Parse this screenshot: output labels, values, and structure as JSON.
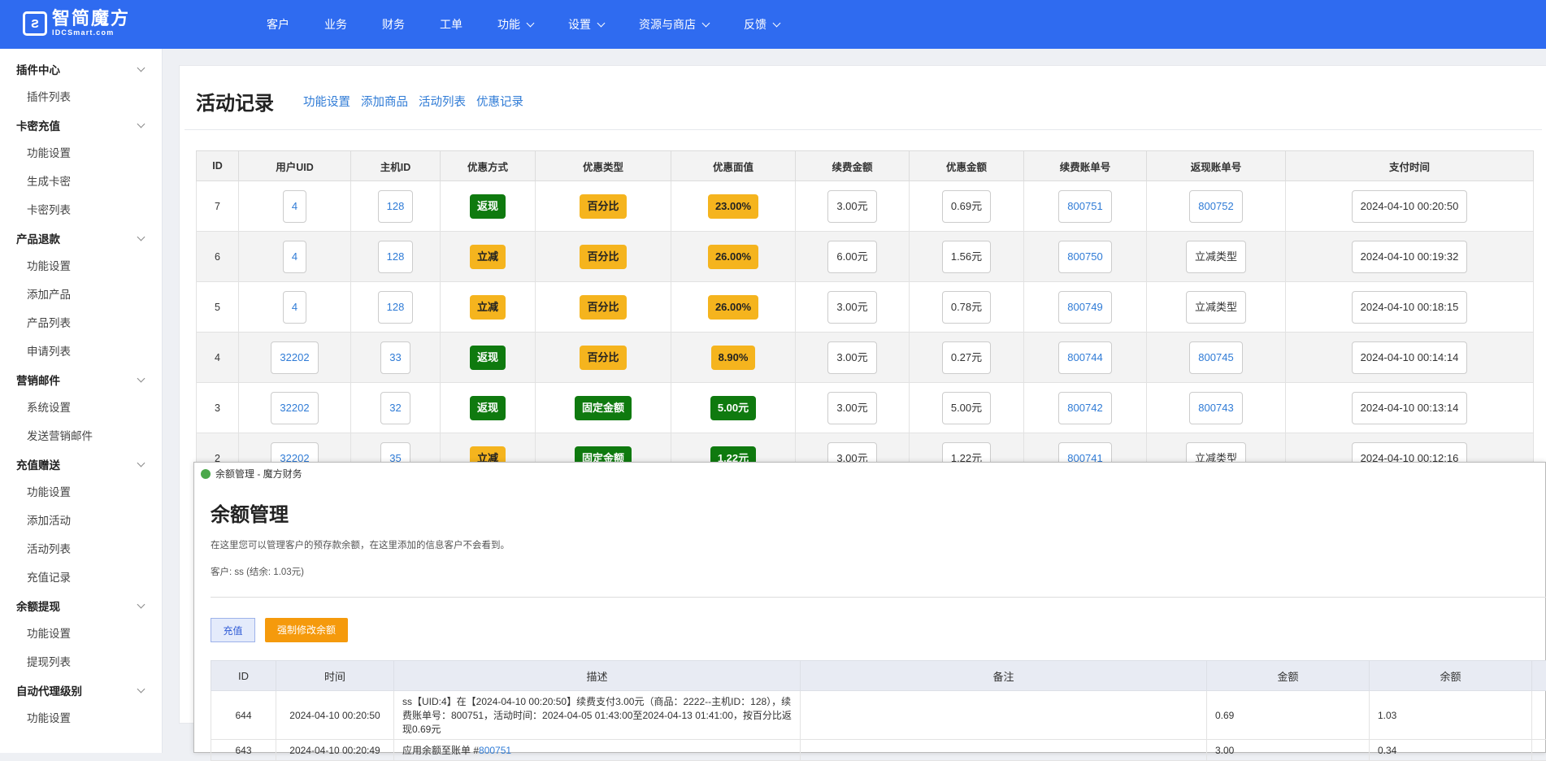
{
  "brand": {
    "name": "智简魔方",
    "sub": "IDCSmart.com"
  },
  "nav": [
    {
      "label": "客户",
      "dropdown": false
    },
    {
      "label": "业务",
      "dropdown": false
    },
    {
      "label": "财务",
      "dropdown": false
    },
    {
      "label": "工单",
      "dropdown": false
    },
    {
      "label": "功能",
      "dropdown": true
    },
    {
      "label": "设置",
      "dropdown": true
    },
    {
      "label": "资源与商店",
      "dropdown": true
    },
    {
      "label": "反馈",
      "dropdown": true
    }
  ],
  "sidebar": [
    {
      "title": "插件中心",
      "items": [
        "插件列表"
      ]
    },
    {
      "title": "卡密充值",
      "items": [
        "功能设置",
        "生成卡密",
        "卡密列表"
      ]
    },
    {
      "title": "产品退款",
      "items": [
        "功能设置",
        "添加产品",
        "产品列表",
        "申请列表"
      ]
    },
    {
      "title": "营销邮件",
      "items": [
        "系统设置",
        "发送营销邮件"
      ]
    },
    {
      "title": "充值赠送",
      "items": [
        "功能设置",
        "添加活动",
        "活动列表",
        "充值记录"
      ]
    },
    {
      "title": "余额提现",
      "items": [
        "功能设置",
        "提现列表"
      ]
    },
    {
      "title": "自动代理级别",
      "items": [
        "功能设置"
      ]
    }
  ],
  "page": {
    "title": "活动记录",
    "tabs": [
      "功能设置",
      "添加商品",
      "活动列表",
      "优惠记录"
    ]
  },
  "records": {
    "columns": [
      "ID",
      "用户UID",
      "主机ID",
      "优惠方式",
      "优惠类型",
      "优惠面值",
      "续费金额",
      "优惠金额",
      "续费账单号",
      "返现账单号",
      "支付时间"
    ],
    "rows": [
      {
        "id": "7",
        "uid": "4",
        "host": "128",
        "method": "返现",
        "type": "百分比",
        "face": "23.00%",
        "renew": "3.00元",
        "discount": "0.69元",
        "renew_bill": "800751",
        "cash_bill": "800752",
        "time": "2024-04-10 00:20:50"
      },
      {
        "id": "6",
        "uid": "4",
        "host": "128",
        "method": "立减",
        "type": "百分比",
        "face": "26.00%",
        "renew": "6.00元",
        "discount": "1.56元",
        "renew_bill": "800750",
        "cash_bill": "立减类型",
        "time": "2024-04-10 00:19:32"
      },
      {
        "id": "5",
        "uid": "4",
        "host": "128",
        "method": "立减",
        "type": "百分比",
        "face": "26.00%",
        "renew": "3.00元",
        "discount": "0.78元",
        "renew_bill": "800749",
        "cash_bill": "立减类型",
        "time": "2024-04-10 00:18:15"
      },
      {
        "id": "4",
        "uid": "32202",
        "host": "33",
        "method": "返现",
        "type": "百分比",
        "face": "8.90%",
        "renew": "3.00元",
        "discount": "0.27元",
        "renew_bill": "800744",
        "cash_bill": "800745",
        "time": "2024-04-10 00:14:14"
      },
      {
        "id": "3",
        "uid": "32202",
        "host": "32",
        "method": "返现",
        "type": "固定金额",
        "face": "5.00元",
        "renew": "3.00元",
        "discount": "5.00元",
        "renew_bill": "800742",
        "cash_bill": "800743",
        "time": "2024-04-10 00:13:14"
      },
      {
        "id": "2",
        "uid": "32202",
        "host": "35",
        "method": "立减",
        "type": "固定金额",
        "face": "1.22元",
        "renew": "3.00元",
        "discount": "1.22元",
        "renew_bill": "800741",
        "cash_bill": "立减类型",
        "time": "2024-04-10 00:12:16"
      }
    ]
  },
  "modal": {
    "window_title": "余额管理 - 魔方财务",
    "heading": "余额管理",
    "description": "在这里您可以管理客户的预存款余额，在这里添加的信息客户不会看到。",
    "customer": "客户: ss (结余: 1.03元)",
    "recharge_label": "充值",
    "force_label": "强制修改余额",
    "columns": [
      "ID",
      "时间",
      "描述",
      "备注",
      "金额",
      "余额"
    ],
    "rows": [
      {
        "id": "644",
        "time": "2024-04-10 00:20:50",
        "desc_text": "ss【UID:4】在【2024-04-10 00:20:50】续费支付3.00元（商品：2222--主机ID：128），续费账单号：800751，活动时间：2024-04-05 01:43:00至2024-04-13 01:41:00，按百分比返现0.69元",
        "desc_link": "",
        "note": "",
        "amount": "0.69",
        "balance": "1.03"
      },
      {
        "id": "643",
        "time": "2024-04-10 00:20:49",
        "desc_text": "应用余额至账单 #",
        "desc_link": "800751",
        "note": "",
        "amount": "3.00",
        "balance": "0.34"
      }
    ]
  },
  "colors": {
    "topbar": "#2f6bf0",
    "green_badge": "#0f7a0f",
    "yellow_badge": "#f5b41e",
    "link": "#2f7bd6",
    "orange_button": "#f59a0c"
  }
}
